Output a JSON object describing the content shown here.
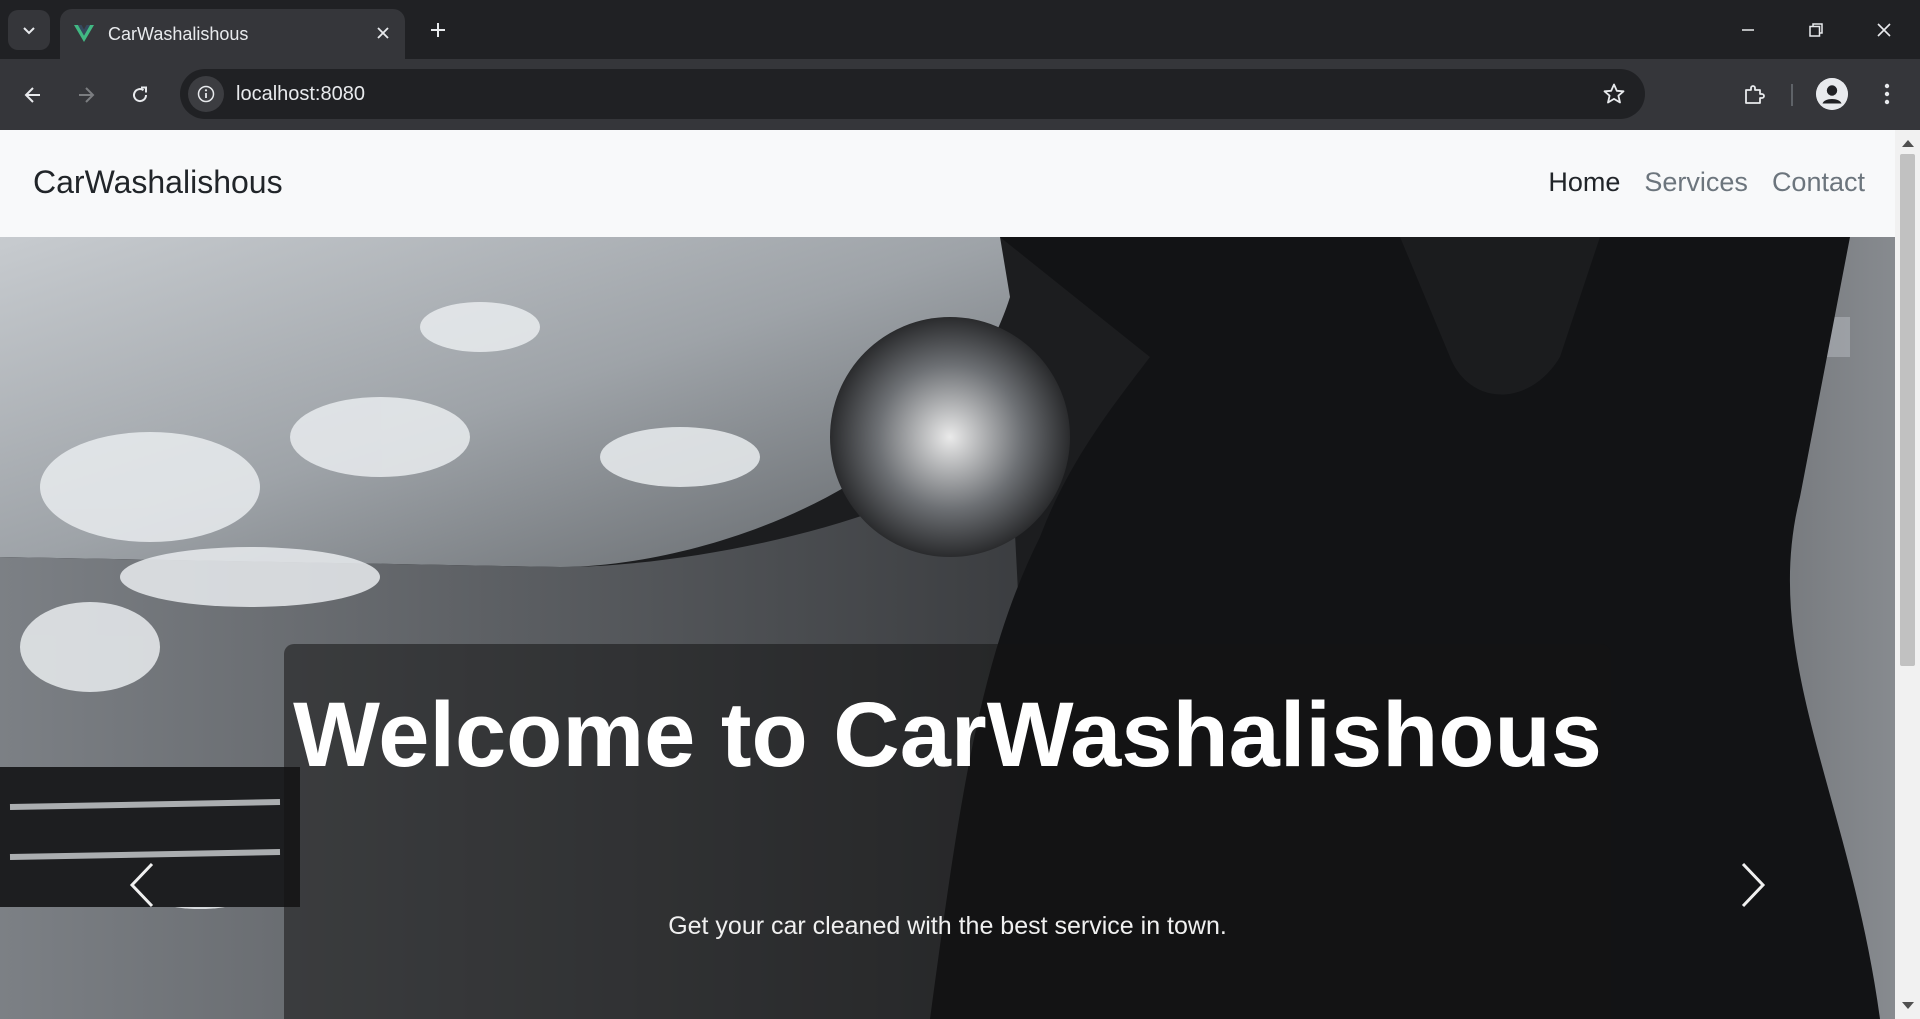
{
  "browser": {
    "tab_title": "CarWashalishous",
    "url": "localhost:8080",
    "icons": {
      "tab_search": "chevron-down-icon",
      "favicon": "vue-logo-icon",
      "close_tab": "close-icon",
      "new_tab": "plus-icon",
      "minimize": "minimize-icon",
      "restore": "restore-icon",
      "close_window": "close-icon",
      "back": "back-arrow-icon",
      "forward": "forward-arrow-icon",
      "reload": "reload-icon",
      "site_info": "info-icon",
      "bookmark": "star-icon",
      "extensions": "puzzle-icon",
      "profile": "person-icon",
      "menu": "kebab-menu-icon"
    }
  },
  "site": {
    "brand": "CarWashalishous",
    "nav": [
      {
        "label": "Home",
        "active": true
      },
      {
        "label": "Services",
        "active": false
      },
      {
        "label": "Contact",
        "active": false
      }
    ],
    "hero": {
      "title": "Welcome to CarWashalishous",
      "subtitle": "Get your car cleaned with the best service in town.",
      "icons": {
        "prev": "chevron-left-icon",
        "next": "chevron-right-icon"
      }
    }
  },
  "colors": {
    "chrome_dark": "#202124",
    "chrome_toolbar": "#35363a",
    "vue_green": "#41b883",
    "nav_bg": "#f8f9fa",
    "nav_active": "#212529",
    "nav_muted": "#6c757d"
  }
}
